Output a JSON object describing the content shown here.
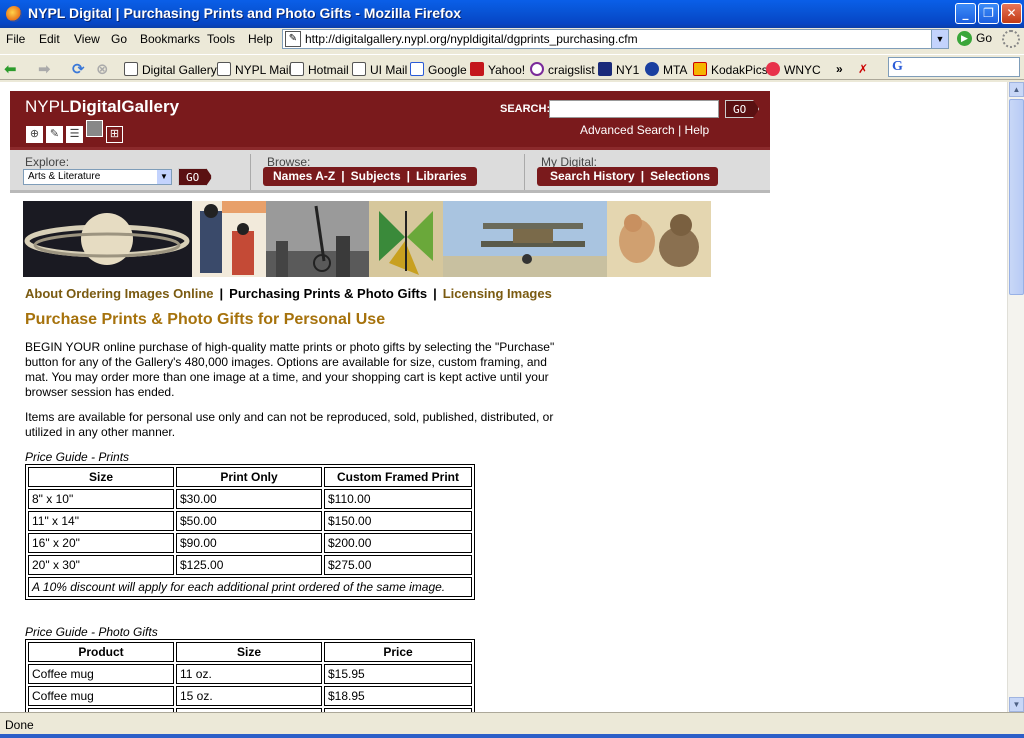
{
  "window": {
    "title": "NYPL Digital | Purchasing Prints and Photo Gifts - Mozilla Firefox",
    "controls": [
      "_",
      "❐",
      "✕"
    ]
  },
  "menubar": {
    "items": [
      "File",
      "Edit",
      "View",
      "Go",
      "Bookmarks",
      "Tools",
      "Help"
    ],
    "url": "http://digitalgallery.nypl.org/nypldigital/dgprints_purchasing.cfm",
    "go_label": "Go"
  },
  "bookmarks": {
    "items": [
      "Digital Gallery",
      "NYPL Mail",
      "Hotmail",
      "UI Mail",
      "Google",
      "Yahoo!",
      "craigslist",
      "NY1",
      "MTA",
      "KodakPics",
      "WNYC"
    ],
    "overflow": "»"
  },
  "site": {
    "logo_light": "NYPL",
    "logo_bold": "DigitalGallery",
    "search_label": "SEARCH:",
    "search_go": "GO",
    "advanced_search": "Advanced Search",
    "help": "Help",
    "sep": "|",
    "explore_label": "Explore:",
    "explore_value": "Arts & Literature",
    "explore_go": "GO",
    "browse_label": "Browse:",
    "browse_items": [
      "Names A-Z",
      "Subjects",
      "Libraries"
    ],
    "mydigital_label": "My Digital:",
    "mydigital_items": [
      "Search History",
      "Selections"
    ]
  },
  "tabs": {
    "about": "About Ordering Images Online",
    "purchasing": "Purchasing Prints & Photo Gifts",
    "licensing": "Licensing Images"
  },
  "content": {
    "heading": "Purchase Prints & Photo Gifts for Personal Use",
    "para1": "BEGIN YOUR online purchase of high-quality matte prints or photo gifts by selecting the \"Purchase\" button for any of the Gallery's 480,000 images. Options are available for size, custom framing, and mat. You may order more than one image at a time, and your shopping cart is kept active until your browser session has ended.",
    "para2": "Items are available for personal use only and can not be reproduced, sold, published, distributed, or utilized in any other manner.",
    "prints_caption": "Price Guide - Prints",
    "prints_headers": [
      "Size",
      "Print Only",
      "Custom Framed Print"
    ],
    "prints_rows": [
      [
        "8\" x 10\"",
        "$30.00",
        "$110.00"
      ],
      [
        "11\" x 14\"",
        "$50.00",
        "$150.00"
      ],
      [
        "16\" x 20\"",
        "$90.00",
        "$200.00"
      ],
      [
        "20\" x 30\"",
        "$125.00",
        "$275.00"
      ]
    ],
    "prints_note": "A 10% discount will apply for each additional print ordered of the same image.",
    "gifts_caption": "Price Guide - Photo Gifts",
    "gifts_headers": [
      "Product",
      "Size",
      "Price"
    ],
    "gifts_rows": [
      [
        "Coffee mug",
        "11 oz.",
        "$15.95"
      ],
      [
        "Coffee mug",
        "15 oz.",
        "$18.95"
      ]
    ]
  },
  "status": {
    "text": "Done"
  },
  "colors": {
    "brand": "#7a1a1c",
    "tab_link": "#7a5a10",
    "heading": "#a6720c"
  }
}
